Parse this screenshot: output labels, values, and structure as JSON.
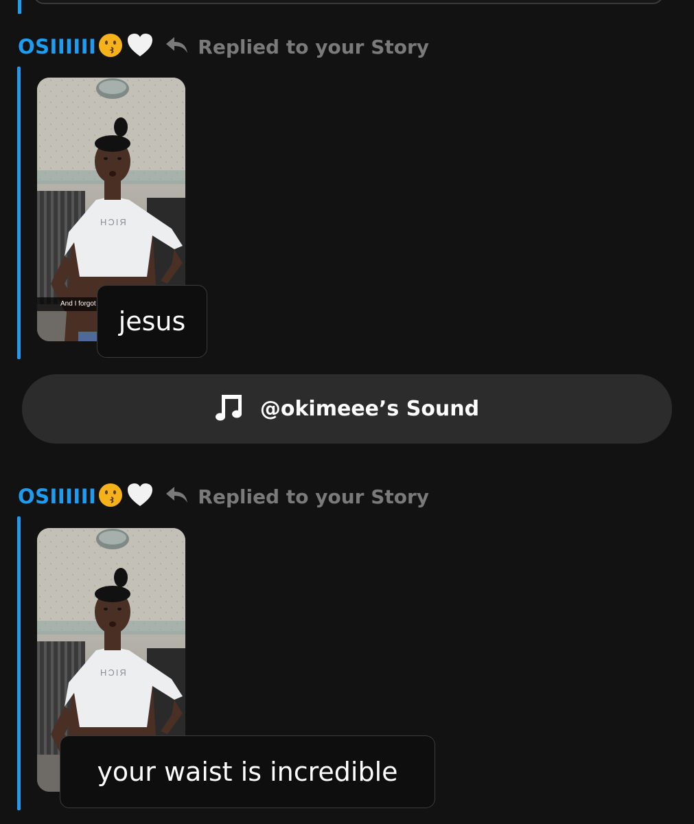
{
  "messages": [
    {
      "sender": "OSIIIIII",
      "reply_label": "Replied to your Story",
      "story_caption": "And I forgot",
      "text": "jesus"
    },
    {
      "sender": "OSIIIIII",
      "reply_label": "Replied to your Story",
      "text": "your waist is incredible"
    }
  ],
  "sound": {
    "label": "@okimeee’s Sound",
    "icon": "music-note-icon"
  },
  "icons": {
    "reaction_emoji": "kissing-face-emoji",
    "heart": "white-heart-icon",
    "reply": "reply-arrow-icon"
  },
  "colors": {
    "accent": "#1e9df0",
    "background": "#121212",
    "muted_text": "#7a7a7a",
    "pill": "#2c2c2c"
  }
}
